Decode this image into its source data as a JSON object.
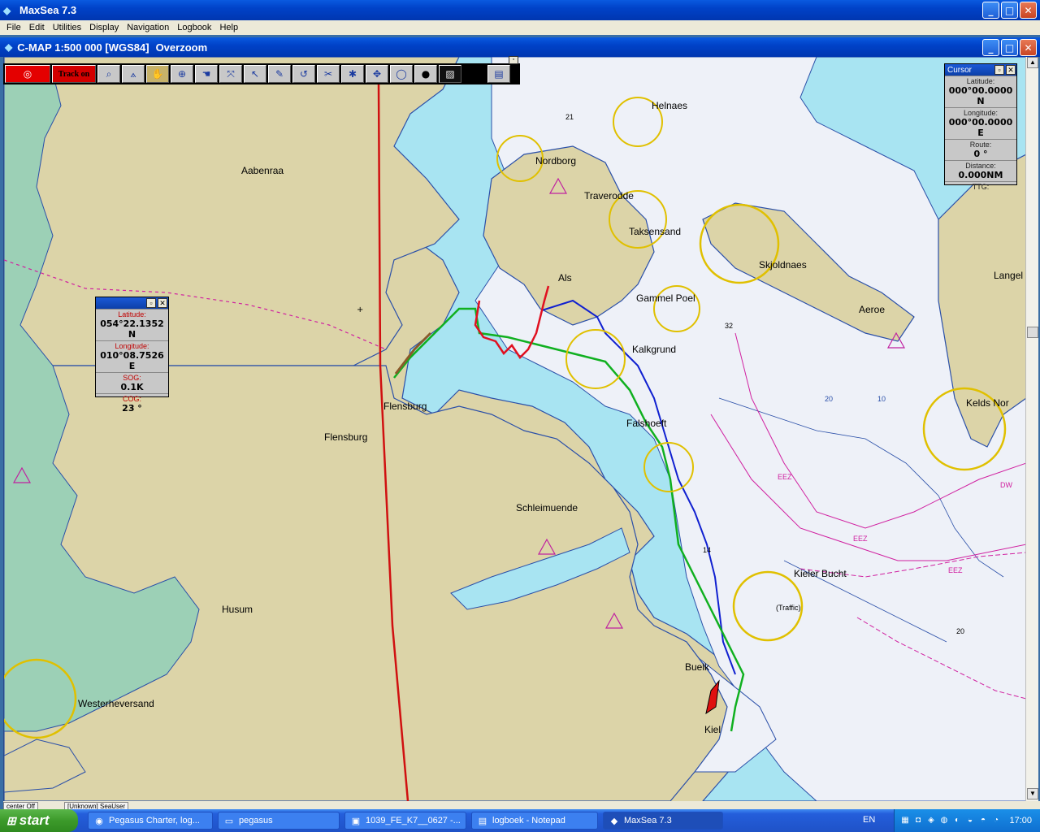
{
  "app": {
    "title": "MaxSea 7.3"
  },
  "menu": [
    "File",
    "Edit",
    "Utilities",
    "Display",
    "Navigation",
    "Logbook",
    "Help"
  ],
  "chart_window": {
    "title": "C-MAP  1:500 000 [WGS84]",
    "mode": "Overzoom"
  },
  "toolbar": {
    "track_label": "Track on"
  },
  "cursor_panel": {
    "title": "Cursor",
    "fields": [
      {
        "label": "Latitude:",
        "value": "000°00.0000 N"
      },
      {
        "label": "Longitude:",
        "value": "000°00.0000 E"
      },
      {
        "label": "Route:",
        "value": "0 °"
      },
      {
        "label": "Distance:",
        "value": "0.000NM"
      },
      {
        "label": "TTG:",
        "value": ""
      }
    ]
  },
  "boat_panel": {
    "fields": [
      {
        "label": "Latitude:",
        "value": "054°22.1352 N"
      },
      {
        "label": "Longitude:",
        "value": "010°08.7526 E"
      },
      {
        "label": "SOG:",
        "value": "0.1K"
      },
      {
        "label": "COG:",
        "value": "23 °"
      }
    ]
  },
  "places": {
    "aabenraa": "Aabenraa",
    "helnaes": "Helnaes",
    "nordborg": "Nordborg",
    "traverodde": "Traverodde",
    "taksensand": "Taksensand",
    "skjoldnaes": "Skjoldnaes",
    "langel": "Langel",
    "als": "Als",
    "gammel_poel": "Gammel Poel",
    "aeroe": "Aeroe",
    "kalkgrund": "Kalkgrund",
    "flensburg1": "Flensburg",
    "flensburg2": "Flensburg",
    "falshoeft": "Falshoeft",
    "kelds_nor": "Kelds Nor",
    "schleimuende": "Schleimuende",
    "kieler_bucht": "Kieler Bucht",
    "husum": "Husum",
    "buelk": "Buelk",
    "kiel": "Kiel",
    "westerheversand": "Westerheversand",
    "traffic": "(Traffic)"
  },
  "depths": {
    "d21": "21",
    "d32": "32",
    "d14": "14",
    "d20": "20",
    "d10": "10",
    "d20b": "20"
  },
  "zones": {
    "eez1": "EEZ",
    "eez2": "EEZ",
    "eez3": "EEZ",
    "dw": "DW"
  },
  "statusbar": {
    "left": "center Off",
    "user": "[Unknown] SeaUser"
  },
  "taskbar": {
    "start": "start",
    "items": [
      {
        "label": "Pegasus Charter, log...",
        "icon": "chrome-icon"
      },
      {
        "label": "pegasus",
        "icon": "folder-icon"
      },
      {
        "label": "1039_FE_K7__0627 -...",
        "icon": "image-icon"
      },
      {
        "label": "logboek - Notepad",
        "icon": "notepad-icon"
      },
      {
        "label": "MaxSea 7.3",
        "icon": "maxsea-icon"
      }
    ],
    "language": "EN",
    "clock": "17:00"
  }
}
